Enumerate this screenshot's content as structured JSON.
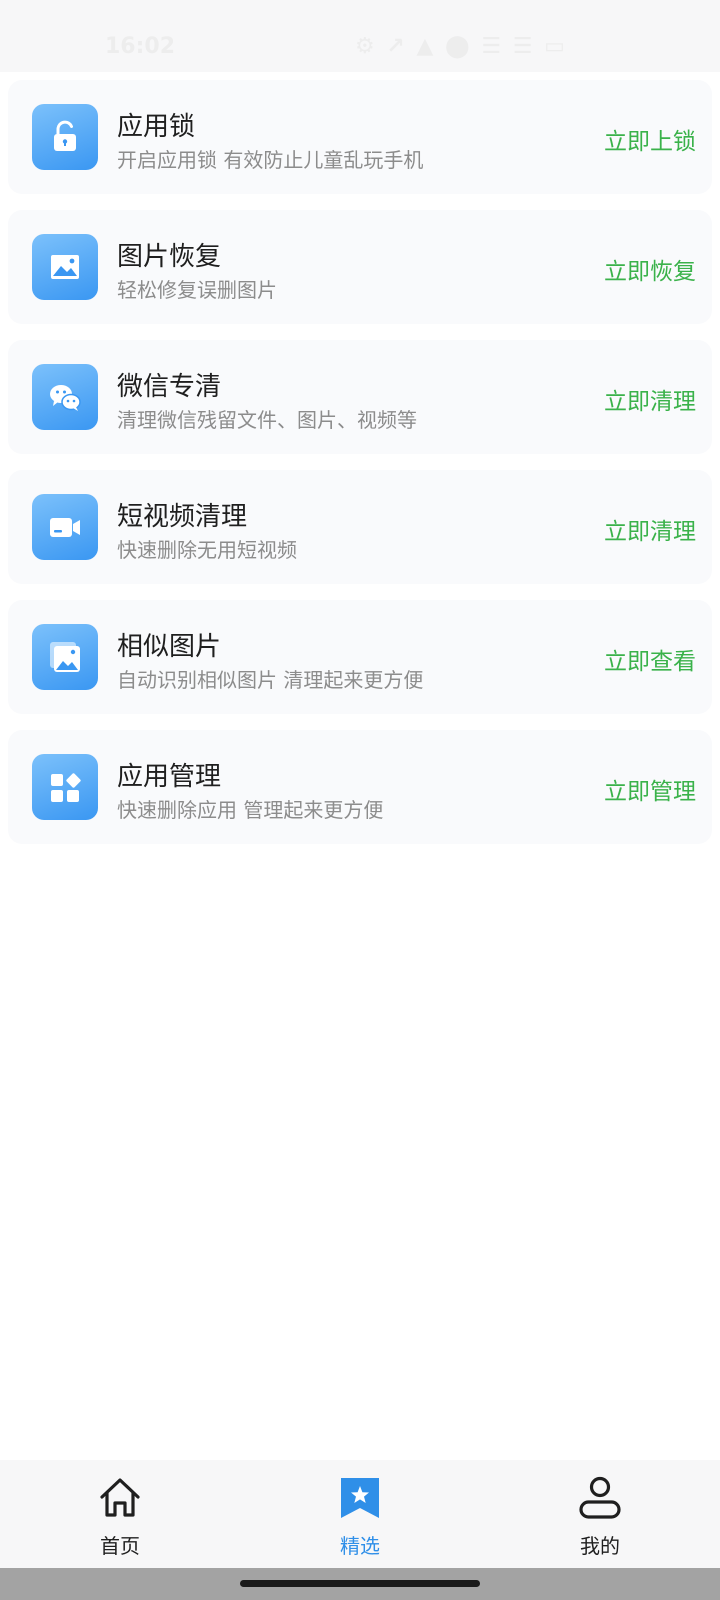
{
  "status_bar": {
    "time": "16:02",
    "indicators": "⚙ ↗ ▲ ⬤ ☰ ☰ ▭"
  },
  "cards": [
    {
      "title": "应用锁",
      "subtitle": "开启应用锁 有效防止儿童乱玩手机",
      "action": "立即上锁",
      "icon": "unlock-icon"
    },
    {
      "title": "图片恢复",
      "subtitle": "轻松修复误删图片",
      "action": "立即恢复",
      "icon": "image-icon"
    },
    {
      "title": "微信专清",
      "subtitle": "清理微信残留文件、图片、视频等",
      "action": "立即清理",
      "icon": "wechat-icon"
    },
    {
      "title": "短视频清理",
      "subtitle": "快速删除无用短视频",
      "action": "立即清理",
      "icon": "video-camera-icon"
    },
    {
      "title": "相似图片",
      "subtitle": "自动识别相似图片 清理起来更方便",
      "action": "立即查看",
      "icon": "similar-images-icon"
    },
    {
      "title": "应用管理",
      "subtitle": "快速删除应用 管理起来更方便",
      "action": "立即管理",
      "icon": "apps-grid-icon"
    }
  ],
  "tabbar": {
    "items": [
      {
        "label": "首页",
        "icon": "home-icon",
        "active": false
      },
      {
        "label": "精选",
        "icon": "bookmark-star-icon",
        "active": true
      },
      {
        "label": "我的",
        "icon": "user-icon",
        "active": false
      }
    ]
  },
  "colors": {
    "accent_green": "#3ab24a",
    "accent_blue": "#2f8fe8",
    "icon_gradient_top": "#7cc1fb",
    "icon_gradient_bottom": "#3a97f2"
  }
}
